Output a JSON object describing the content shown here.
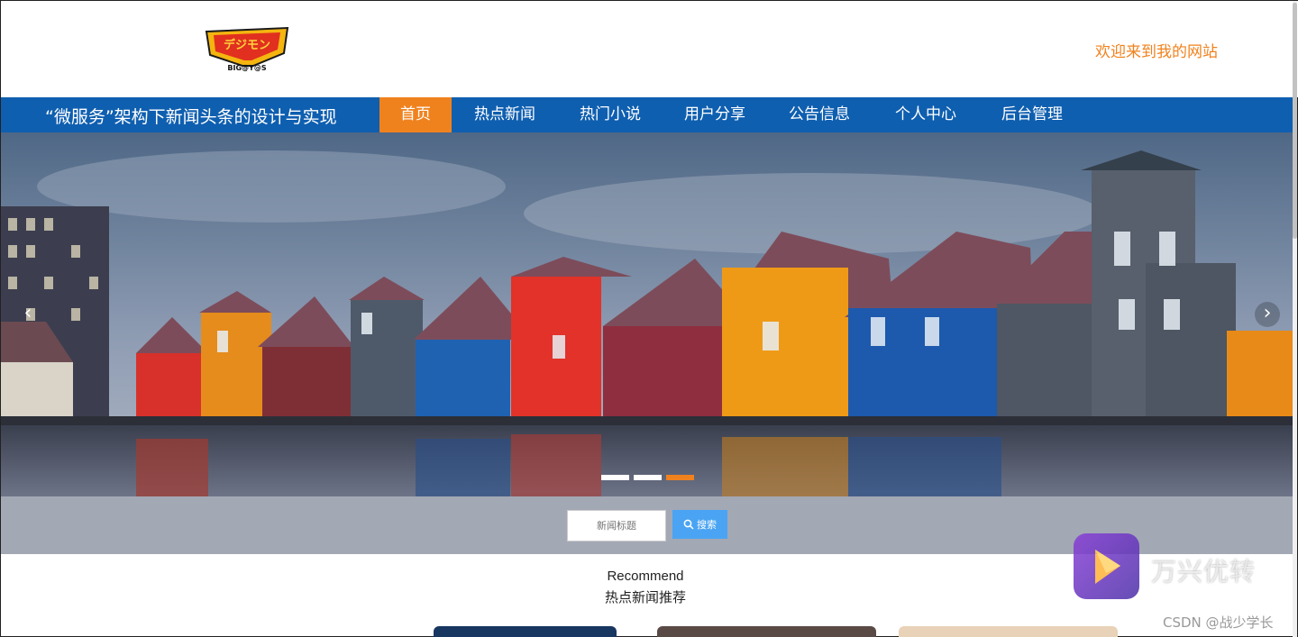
{
  "header": {
    "logo_text": "BIG@Y@S",
    "welcome": "欢迎来到我的网站"
  },
  "nav": {
    "site_title": "“微服务”架构下新闻头条的设计与实现",
    "items": [
      "首页",
      "热点新闻",
      "热门小说",
      "用户分享",
      "公告信息",
      "个人中心",
      "后台管理"
    ],
    "active_index": 0
  },
  "carousel": {
    "prev_icon": "‹",
    "next_icon": "›",
    "slide_count": 3,
    "active_slide": 3
  },
  "search": {
    "placeholder": "新闻标题",
    "button_label": "搜索"
  },
  "recommend": {
    "title_en": "Recommend",
    "title_cn": "热点新闻推荐"
  },
  "watermark": {
    "app_name": "万兴优转",
    "credit": "CSDN @战少学长"
  },
  "colors": {
    "nav_bg": "#0f5fb0",
    "accent": "#f0821e",
    "search_button": "#4aa4f3"
  }
}
